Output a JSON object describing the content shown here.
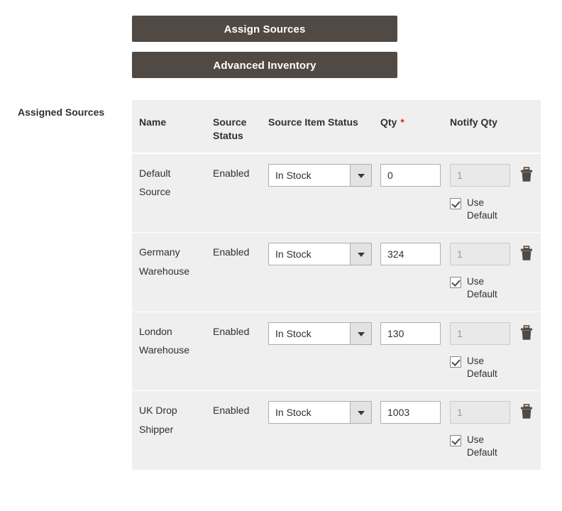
{
  "buttons": {
    "assign_sources": "Assign Sources",
    "advanced_inventory": "Advanced Inventory"
  },
  "field_label": "Assigned Sources",
  "table": {
    "headers": {
      "name": "Name",
      "source_status": "Source\nStatus",
      "source_status_line1": "Source",
      "source_status_line2": "Status",
      "source_item_status": "Source Item Status",
      "qty": "Qty",
      "qty_required_marker": "*",
      "notify_qty": "Notify Qty",
      "actions": ""
    },
    "use_default_label": "Use Default",
    "rows": [
      {
        "name": "Default Source",
        "source_status": "Enabled",
        "source_item_status": "In Stock",
        "qty": "0",
        "notify_qty": "1",
        "notify_qty_disabled": true,
        "use_default_checked": true,
        "delete_icon": "trash-icon"
      },
      {
        "name": "Germany Warehouse",
        "source_status": "Enabled",
        "source_item_status": "In Stock",
        "qty": "324",
        "notify_qty": "1",
        "notify_qty_disabled": true,
        "use_default_checked": true,
        "delete_icon": "trash-icon"
      },
      {
        "name": "London Warehouse",
        "source_status": "Enabled",
        "source_item_status": "In Stock",
        "qty": "130",
        "notify_qty": "1",
        "notify_qty_disabled": true,
        "use_default_checked": true,
        "delete_icon": "trash-icon"
      },
      {
        "name": "UK Drop Shipper",
        "source_status": "Enabled",
        "source_item_status": "In Stock",
        "qty": "1003",
        "notify_qty": "1",
        "notify_qty_disabled": true,
        "use_default_checked": true,
        "delete_icon": "trash-icon"
      }
    ]
  },
  "colors": {
    "button_bg": "#514943",
    "button_text": "#ffffff",
    "table_bg": "#efefef",
    "row_divider": "#ffffff",
    "required_asterisk": "#e22626",
    "text": "#303030",
    "input_border": "#adadad",
    "disabled_input_bg": "#e9e9e9",
    "disabled_input_text": "#999999",
    "trash_icon": "#514943"
  }
}
